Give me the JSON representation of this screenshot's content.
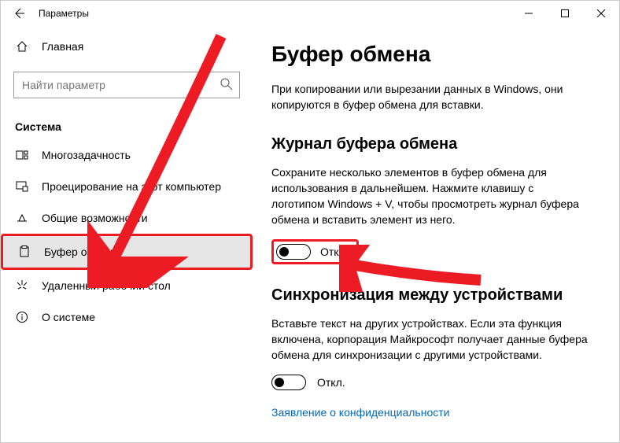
{
  "titlebar": {
    "app_title": "Параметры"
  },
  "sidebar": {
    "home_label": "Главная",
    "search_placeholder": "Найти параметр",
    "group_label": "Система",
    "items": [
      {
        "label": "Многозадачность"
      },
      {
        "label": "Проецирование на этот компьютер"
      },
      {
        "label": "Общие возможности"
      },
      {
        "label": "Буфер обмена"
      },
      {
        "label": "Удаленный рабочий стол"
      },
      {
        "label": "О системе"
      }
    ]
  },
  "content": {
    "title": "Буфер обмена",
    "intro": "При копировании или вырезании данных в Windows, они копируются в буфер обмена для вставки.",
    "history_title": "Журнал буфера обмена",
    "history_desc": "Сохраните несколько элементов в буфер обмена для использования в дальнейшем. Нажмите клавишу с логотипом Windows + V, чтобы просмотреть журнал буфера обмена и вставить элемент из него.",
    "history_toggle_label": "Откл.",
    "sync_title": "Синхронизация между устройствами",
    "sync_desc": "Вставьте текст на других устройствах. Если эта функция включена, корпорация Майкрософт получает данные буфера обмена для синхронизации с другими устройствами.",
    "sync_toggle_label": "Откл.",
    "privacy_link": "Заявление о конфиденциальности"
  }
}
